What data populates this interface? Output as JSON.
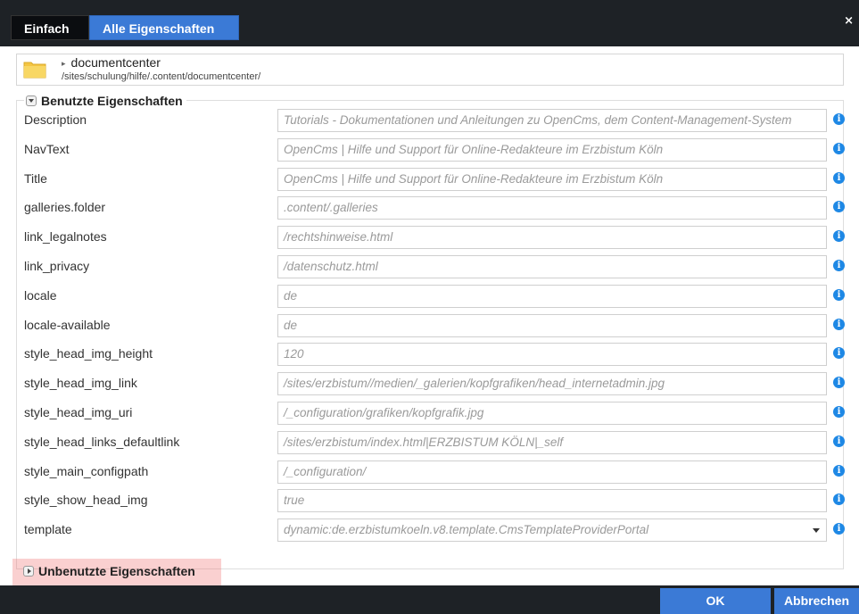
{
  "tabs": [
    {
      "label": "Einfach"
    },
    {
      "label": "Alle Eigenschaften"
    }
  ],
  "close_glyph": "×",
  "resource": {
    "name": "documentcenter",
    "path": "/sites/schulung/hilfe/.content/documentcenter/",
    "icon": "folder-icon"
  },
  "used_section": {
    "title": "Benutzte Eigenschaften"
  },
  "properties": [
    {
      "name": "Description",
      "value": "Tutorials - Dokumentationen und Anleitungen zu OpenCms, dem Content-Management-System"
    },
    {
      "name": "NavText",
      "value": "OpenCms | Hilfe und Support für Online-Redakteure im Erzbistum Köln"
    },
    {
      "name": "Title",
      "value": "OpenCms | Hilfe und Support für Online-Redakteure im Erzbistum Köln"
    },
    {
      "name": "galleries.folder",
      "value": ".content/.galleries"
    },
    {
      "name": "link_legalnotes",
      "value": "/rechtshinweise.html"
    },
    {
      "name": "link_privacy",
      "value": "/datenschutz.html"
    },
    {
      "name": "locale",
      "value": "de"
    },
    {
      "name": "locale-available",
      "value": "de"
    },
    {
      "name": "style_head_img_height",
      "value": "120"
    },
    {
      "name": "style_head_img_link",
      "value": "/sites/erzbistum//medien/_galerien/kopfgrafiken/head_internetadmin.jpg"
    },
    {
      "name": "style_head_img_uri",
      "value": "/_configuration/grafiken/kopfgrafik.jpg"
    },
    {
      "name": "style_head_links_defaultlink",
      "value": "/sites/erzbistum/index.html|ERZBISTUM KÖLN|_self"
    },
    {
      "name": "style_main_configpath",
      "value": "/_configuration/"
    },
    {
      "name": "style_show_head_img",
      "value": "true"
    },
    {
      "name": "template",
      "value": "dynamic:de.erzbistumkoeln.v8.template.CmsTemplateProviderPortal"
    }
  ],
  "unused_section": {
    "title": "Unbenutzte Eigenschaften"
  },
  "buttons": {
    "ok": "OK",
    "cancel": "Abbrechen"
  },
  "colors": {
    "accent": "#3b7ad6",
    "dark": "#1e2226",
    "info": "#1e88e5",
    "highlight": "#e07a7a"
  }
}
